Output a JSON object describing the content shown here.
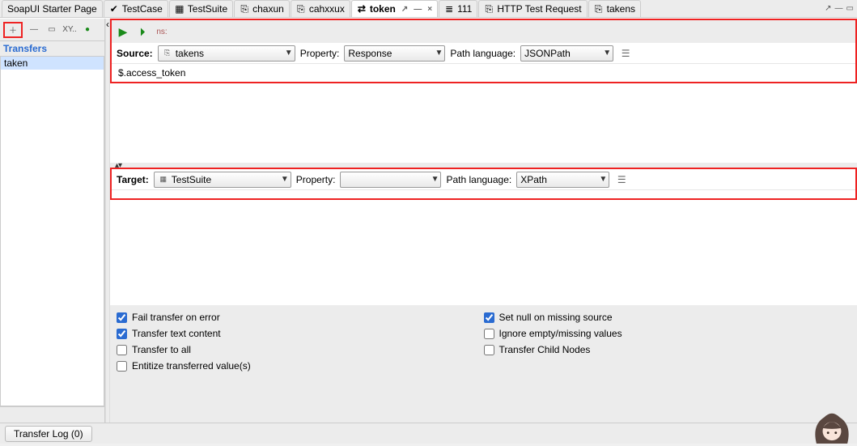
{
  "tabs": {
    "items": [
      {
        "label": "SoapUI Starter Page",
        "active": false,
        "icon": ""
      },
      {
        "label": "TestCase",
        "active": false,
        "icon": "tc"
      },
      {
        "label": "TestSuite",
        "active": false,
        "icon": "ts"
      },
      {
        "label": "chaxun",
        "active": false,
        "icon": "ht"
      },
      {
        "label": "cahxxux",
        "active": false,
        "icon": "ht"
      },
      {
        "label": "token",
        "active": true,
        "icon": "tr",
        "closeable": true
      },
      {
        "label": "111",
        "active": false,
        "icon": "li"
      },
      {
        "label": "HTTP Test Request",
        "active": false,
        "icon": "ht"
      },
      {
        "label": "takens",
        "active": false,
        "icon": "ht"
      }
    ]
  },
  "sidebar": {
    "title": "Transfers",
    "items": [
      "taken"
    ],
    "tool_xy": "XY.."
  },
  "toolbar": {
    "ns_label": "ns:"
  },
  "source": {
    "label": "Source:",
    "step": "takens",
    "property_label": "Property:",
    "property": "Response",
    "pathlang_label": "Path language:",
    "pathlang": "JSONPath",
    "expression": "$.access_token"
  },
  "target": {
    "label": "Target:",
    "step": "TestSuite",
    "property_label": "Property:",
    "property": "",
    "pathlang_label": "Path language:",
    "pathlang": "XPath"
  },
  "checks": {
    "fail_on_error": "Fail transfer on error",
    "transfer_text": "Transfer text content",
    "transfer_all": "Transfer to all",
    "entitize": "Entitize transferred value(s)",
    "set_null": "Set null on missing source",
    "ignore_empty": "Ignore empty/missing values",
    "child_nodes": "Transfer Child Nodes"
  },
  "bottom": {
    "log": "Transfer Log (0)"
  }
}
